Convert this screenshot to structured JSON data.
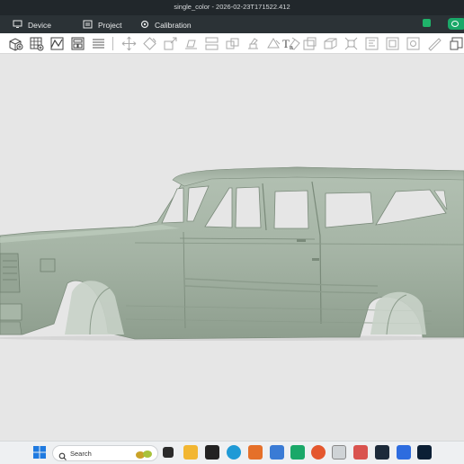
{
  "window": {
    "title": "single_color - 2026-02-23T171522.412"
  },
  "menu": {
    "device_label": "Device",
    "project_label": "Project",
    "calibration_label": "Calibration"
  },
  "toolbar": {
    "tools": [
      "add-object-icon",
      "plate-grid-icon",
      "import-icon",
      "arrange-icon",
      "layers-icon",
      "move-icon",
      "rotate-icon",
      "scale-icon",
      "lay-flat-icon",
      "cut-icon",
      "boolean-icon",
      "support-paint-icon",
      "seam-paint-icon",
      "color-paint-icon",
      "text-icon",
      "emboss-icon",
      "measure-icon",
      "assembly-icon",
      "variable-layer-icon",
      "brim-icon",
      "mesh-repair-icon",
      "split-icon",
      "ruler-icon",
      "more-icon"
    ]
  },
  "taskbar": {
    "search_placeholder": "Search",
    "apps": [
      "windows-start-icon",
      "task-view-icon",
      "file-explorer-icon",
      "terminal-icon",
      "edge-icon",
      "fusion-app-icon",
      "photos-icon",
      "slicer-app-icon",
      "firefox-icon",
      "shield-app-icon",
      "calculator-icon",
      "3d-app-icon",
      "printer-app-icon",
      "photoshop-icon",
      "bambu-app-icon"
    ]
  },
  "colors": {
    "titlebar": "#21272b",
    "menubar": "#2b3236",
    "accent": "#1aa869",
    "model": "#a3b2a3",
    "canvas": "#e6e6e6"
  }
}
